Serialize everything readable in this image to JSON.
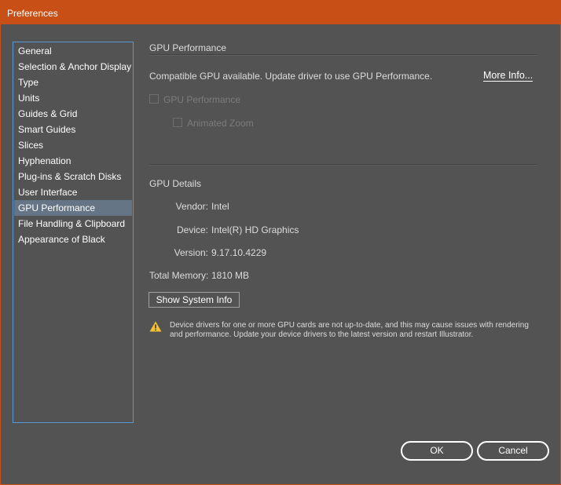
{
  "window": {
    "title": "Preferences"
  },
  "sidebar": {
    "items": [
      {
        "label": "General"
      },
      {
        "label": "Selection & Anchor Display"
      },
      {
        "label": "Type"
      },
      {
        "label": "Units"
      },
      {
        "label": "Guides & Grid"
      },
      {
        "label": "Smart Guides"
      },
      {
        "label": "Slices"
      },
      {
        "label": "Hyphenation"
      },
      {
        "label": "Plug-ins & Scratch Disks"
      },
      {
        "label": "User Interface"
      },
      {
        "label": "GPU Performance"
      },
      {
        "label": "File Handling & Clipboard"
      },
      {
        "label": "Appearance of Black"
      }
    ],
    "selected": "GPU Performance"
  },
  "gpu_performance": {
    "section_title": "GPU Performance",
    "status": "Compatible GPU available. Update driver to use GPU Performance.",
    "more_info": "More Info...",
    "gpu_performance_checkbox": {
      "label": "GPU Performance",
      "checked": false,
      "disabled": true
    },
    "animated_zoom_checkbox": {
      "label": "Animated Zoom",
      "checked": false,
      "disabled": true
    }
  },
  "gpu_details": {
    "section_title": "GPU Details",
    "vendor_label": "Vendor:",
    "vendor_value": "Intel",
    "device_label": "Device:",
    "device_value": "Intel(R) HD Graphics",
    "version_label": "Version:",
    "version_value": "9.17.10.4229",
    "memory_label": "Total Memory:",
    "memory_value": "1810 MB",
    "show_system_info": "Show System Info",
    "warning": "Device drivers for one or more GPU cards are not up-to-date, and this may cause issues with rendering and performance. Update your device drivers to the latest version and restart Illustrator."
  },
  "buttons": {
    "ok": "OK",
    "cancel": "Cancel"
  },
  "colors": {
    "titlebar": "#c85016",
    "background": "#535353",
    "selection": "#667586",
    "sidebar_border": "#5a98d6",
    "warning_icon": "#f2c230"
  }
}
